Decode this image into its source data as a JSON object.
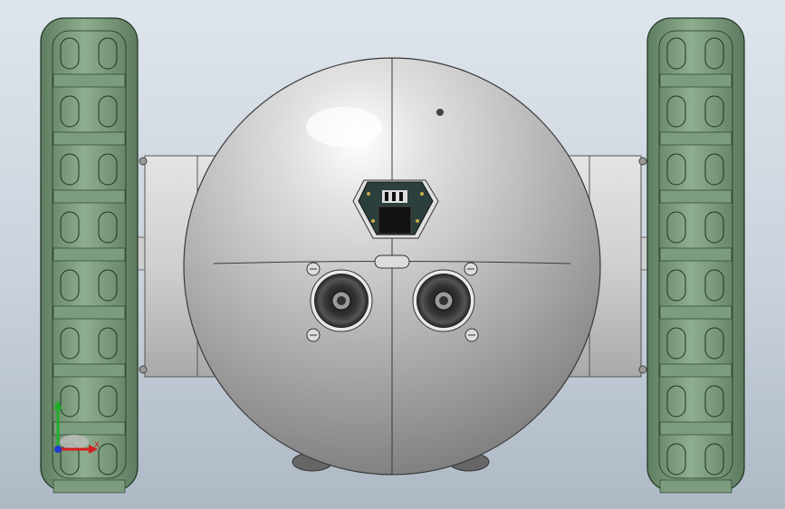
{
  "viewport": {
    "background_top": "#dfe5ec",
    "background_bottom": "#aeb9c6"
  },
  "model": {
    "body_color": "#c8c8c8",
    "wheel_color": "#6f8f72",
    "wheel_edge_color": "#1e3320",
    "sensor_color": "#2a2a2a",
    "pcb_color": "#2b3f3c"
  },
  "triad": {
    "x_label": "X",
    "y_label": "Y",
    "x_color": "#d11f1f",
    "y_color": "#1fae2a",
    "z_color": "#1f3bd1",
    "icon": "coordinate-triad-icon"
  }
}
